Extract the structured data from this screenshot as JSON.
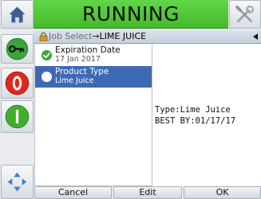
{
  "status": {
    "text": "RUNNING"
  },
  "breadcrumb": {
    "parent": "Job Select",
    "separator": "→",
    "current": "LIME JUICE"
  },
  "list": {
    "items": [
      {
        "title": "Expiration Date",
        "subtitle": "17 Jan 2017",
        "selected": false
      },
      {
        "title": "Product Type",
        "subtitle": "Lime Juice",
        "selected": true
      }
    ]
  },
  "preview": {
    "lines": [
      "Type:Lime  Juice",
      "BEST  BY:01/17/17"
    ]
  },
  "buttons": {
    "cancel": "Cancel",
    "edit": "Edit",
    "ok": "OK"
  },
  "colors": {
    "running": "#4cc634",
    "selection": "#3e6ab3",
    "stop": "#e0281e",
    "start": "#3fb02c"
  },
  "icons": [
    "home-icon",
    "key-icon",
    "stop-icon",
    "start-icon",
    "navigate-arrows-icon",
    "tools-icon",
    "lock-icon",
    "collapse-arrow-icon"
  ]
}
